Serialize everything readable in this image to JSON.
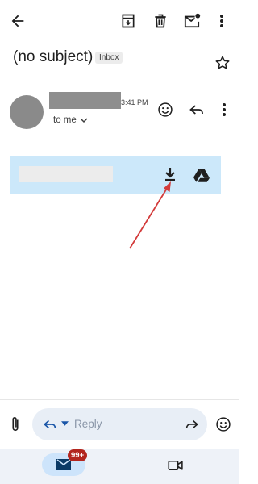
{
  "toolbar": {
    "back_icon": "arrow-back-icon",
    "archive_icon": "archive-icon",
    "delete_icon": "trash-icon",
    "mark_unread_icon": "mark-unread-icon",
    "more_icon": "more-vert-icon"
  },
  "email": {
    "subject": "(no subject)",
    "label": "Inbox",
    "time": "3:41 PM",
    "recipients": "to me"
  },
  "attachment": {
    "download_icon": "download-icon",
    "drive_icon": "google-drive-icon"
  },
  "reply_bar": {
    "placeholder": "Reply"
  },
  "bottom_nav": {
    "mail_badge": "99+",
    "active_color": "#cde4fb",
    "badge_color": "#b3261e"
  },
  "colors": {
    "attachment_bg": "#cce8fa",
    "annotation_arrow": "#d33b3b"
  }
}
